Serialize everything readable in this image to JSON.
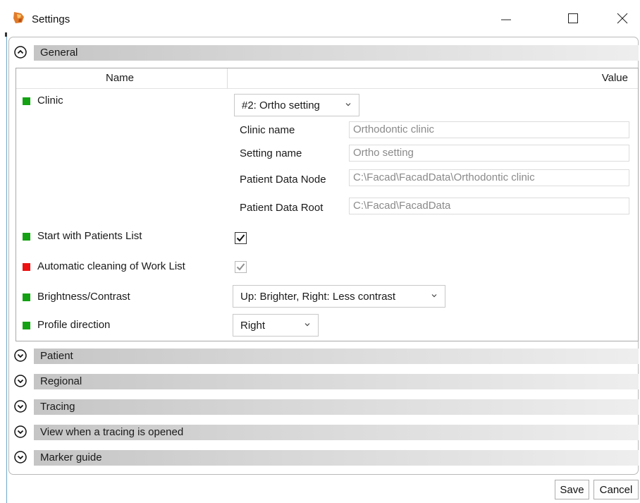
{
  "window": {
    "title": "Settings",
    "buttons": {
      "minimize": "minimize-icon",
      "maximize": "maximize-icon",
      "close": "close-icon"
    }
  },
  "colors": {
    "enabled_marker": "#14a214",
    "warning_marker": "#ee1111",
    "section_bar": "#c5c5c5"
  },
  "sections": [
    {
      "label": "General",
      "expanded": true
    },
    {
      "label": "Patient",
      "expanded": false
    },
    {
      "label": "Regional",
      "expanded": false
    },
    {
      "label": "Tracing",
      "expanded": false
    },
    {
      "label": "View when a tracing is opened",
      "expanded": false
    },
    {
      "label": "Marker guide",
      "expanded": false
    }
  ],
  "grid": {
    "header": {
      "name": "Name",
      "value": "Value"
    },
    "clinic": {
      "label": "Clinic",
      "selected": "#2: Ortho setting",
      "fields": [
        {
          "label": "Clinic name",
          "value": "Orthodontic clinic"
        },
        {
          "label": "Setting name",
          "value": "Ortho setting"
        },
        {
          "label": "Patient Data Node",
          "value": "C:\\Facad\\FacadData\\Orthodontic clinic"
        },
        {
          "label": "Patient Data Root",
          "value": "C:\\Facad\\FacadData"
        }
      ]
    },
    "start_with_patients_list": {
      "label": "Start with Patients List",
      "checked": true
    },
    "automatic_cleaning": {
      "label": "Automatic cleaning of Work List",
      "checked": true,
      "disabled": true
    },
    "brightness_contrast": {
      "label": "Brightness/Contrast",
      "selected": "Up: Brighter, Right: Less contrast"
    },
    "profile_direction": {
      "label": "Profile direction",
      "selected": "Right"
    }
  },
  "footer": {
    "save_label": "Save",
    "cancel_label": "Cancel"
  }
}
